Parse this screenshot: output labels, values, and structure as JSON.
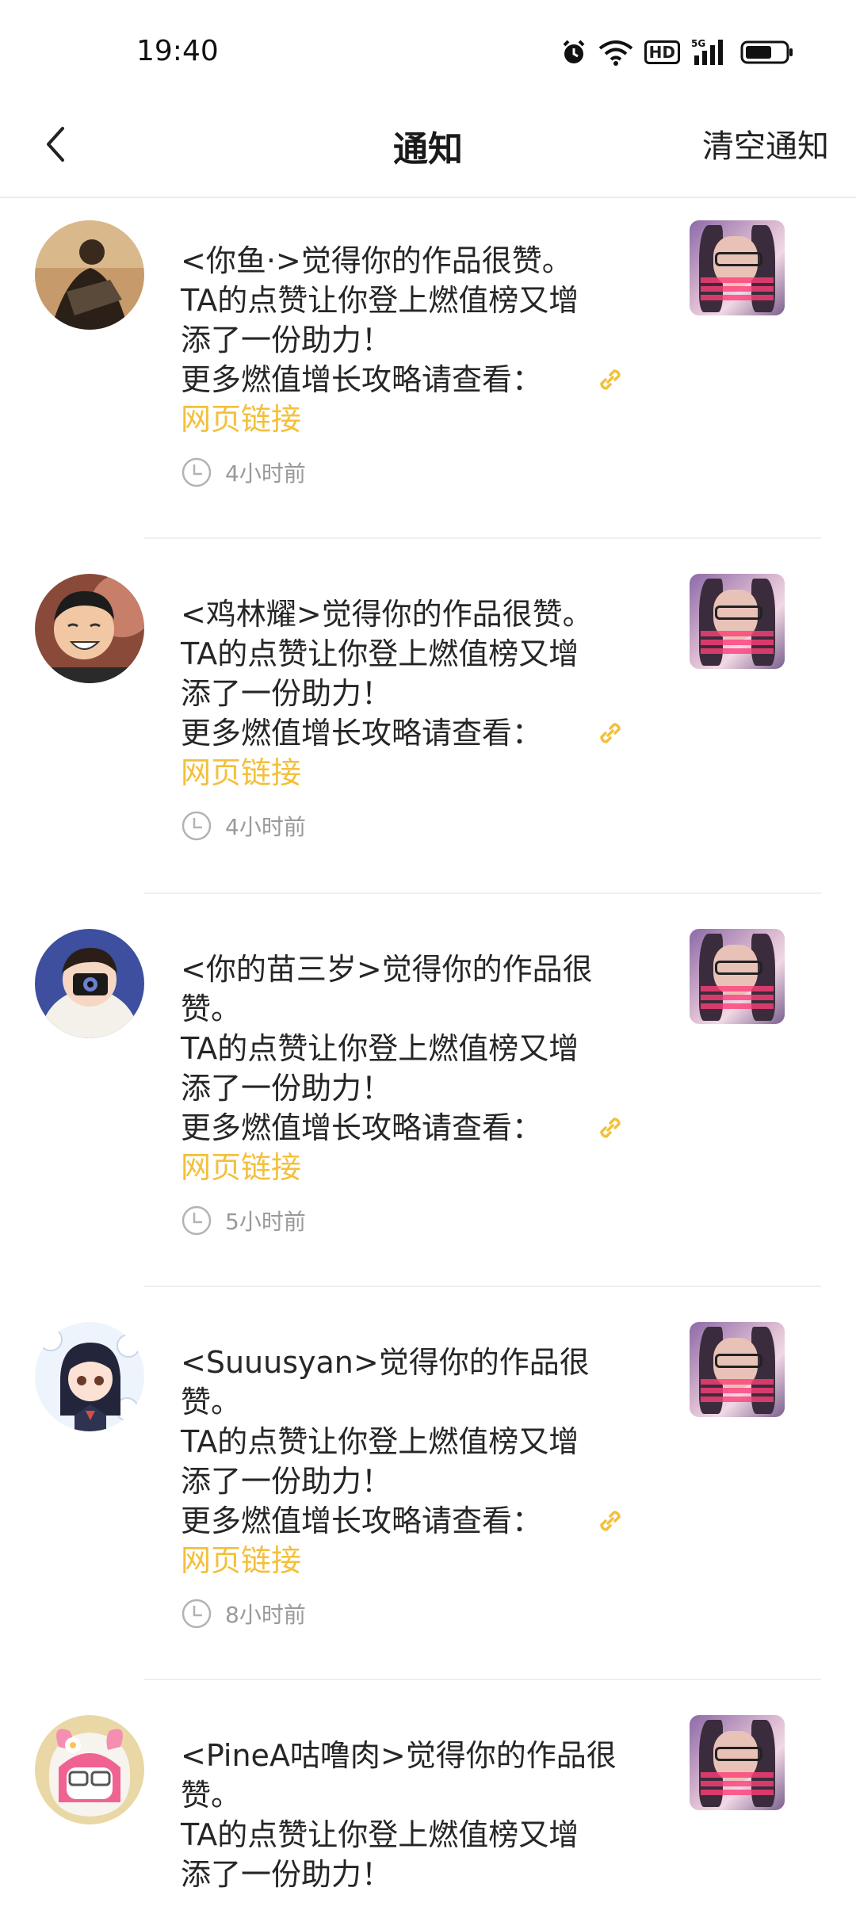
{
  "status": {
    "time": "19:40",
    "hd": "HD",
    "net": "5G"
  },
  "nav": {
    "title": "通知",
    "clear_label": "清空通知"
  },
  "notifications": [
    {
      "user": "<你鱼·>觉得你的作品很赞。",
      "line2": "TA的点赞让你登上燃值榜又增",
      "line3": "添了一份助力！",
      "guide": "更多燃值增长攻略请查看：",
      "link": "网页链接",
      "time": "4小时前"
    },
    {
      "user": "<鸡林耀>觉得你的作品很赞。",
      "line2": "TA的点赞让你登上燃值榜又增",
      "line3": "添了一份助力！",
      "guide": "更多燃值增长攻略请查看：",
      "link": "网页链接",
      "time": "4小时前"
    },
    {
      "user": "<你的苗三岁>觉得你的作品很赞。",
      "line2": "TA的点赞让你登上燃值榜又增",
      "line3": "添了一份助力！",
      "guide": "更多燃值增长攻略请查看：",
      "link": "网页链接",
      "time": "5小时前"
    },
    {
      "user": "<Suuusyan>觉得你的作品很赞。",
      "line2": "TA的点赞让你登上燃值榜又增",
      "line3": "添了一份助力！",
      "guide": "更多燃值增长攻略请查看：",
      "link": "网页链接",
      "time": "8小时前"
    },
    {
      "user": "<PineA咕噜肉>觉得你的作品很赞。",
      "line2": "TA的点赞让你登上燃值榜又增",
      "line3": "添了一份助力！",
      "guide": "",
      "link": "",
      "time": ""
    }
  ]
}
